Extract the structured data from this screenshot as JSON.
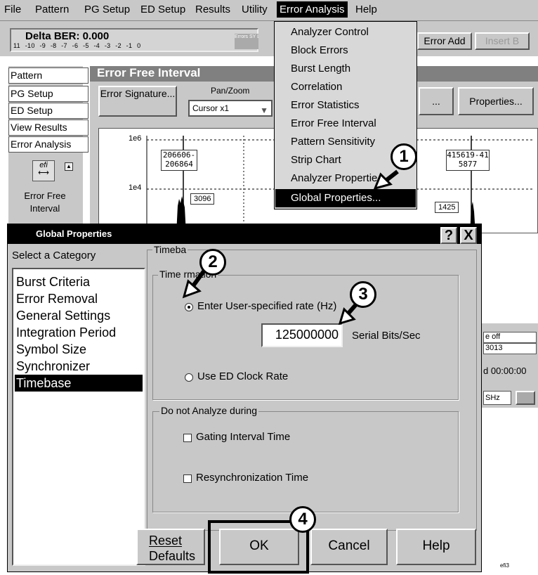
{
  "menubar": {
    "items": [
      "File",
      "Pattern",
      "PG Setup",
      "ED Setup",
      "Results",
      "Utility",
      "Error Analysis",
      "Help"
    ]
  },
  "toolbar": {
    "ber_title": "Delta BER: 0.000",
    "ber_scale": "11 -10 -9 -8 -7 -6 -5 -4 -3 -2 -1 0",
    "ber_status": "Errors SY LO",
    "error_add": "Error Add",
    "insert_b": "Insert B"
  },
  "sidenav": {
    "items": [
      "Pattern",
      "PG Setup",
      "ED Setup",
      "View Results",
      "Error Analysis"
    ],
    "icon_label": "efi",
    "caption": "Error Free Interval"
  },
  "efi_view": {
    "header": "Error Free Interval",
    "signature_btn": "Error Signature...",
    "panzoom_label": "Pan/Zoom",
    "panzoom_value": "Cursor x1",
    "dots_btn": "...",
    "properties_btn": "Properties...",
    "y_labels": [
      "1e6",
      "1e4"
    ],
    "left_range": "206606-206864",
    "left_tag": "3096",
    "right_range": "415619-415877",
    "right_tag": "1425"
  },
  "right_strip": {
    "line1": "e off",
    "line2": "3013",
    "line3": "d 00:00:00",
    "line4": "SHz"
  },
  "error_analysis_menu": {
    "items": [
      "Analyzer Control",
      "Block Errors",
      "Burst Length",
      "Correlation",
      "Error Statistics",
      "Error Free Interval",
      "Pattern Sensitivity",
      "Strip Chart",
      "Analyzer Propertie",
      "Global Properties..."
    ],
    "selected_index": 9
  },
  "dialog": {
    "title": "Global Properties",
    "help_btn": "?",
    "close_btn": "X",
    "category_label": "Select a Category",
    "categories": [
      "Burst Criteria",
      "Error Removal",
      "General Settings",
      "Integration Period",
      "Symbol Size",
      "Synchronizer",
      "Timebase"
    ],
    "selected_category": "Timebase",
    "timebase_legend": "Timeba",
    "time_info_legend": "Time    rmation",
    "radio_user_rate": "Enter User-specified rate (Hz)",
    "rate_value": "125000000",
    "rate_unit": "Serial Bits/Sec",
    "radio_ed_clock": "Use ED Clock Rate",
    "no_analyze_legend": "Do not Analyze during",
    "chk_gating": "Gating Interval Time",
    "chk_resync": "Resynchronization Time",
    "reset_btn_line1": "Reset",
    "reset_btn_line2": "Defaults",
    "ok_btn": "OK",
    "cancel_btn": "Cancel",
    "help_btn_label": "Help"
  },
  "callouts": [
    "1",
    "2",
    "3",
    "4"
  ],
  "figure_id": "efi3"
}
